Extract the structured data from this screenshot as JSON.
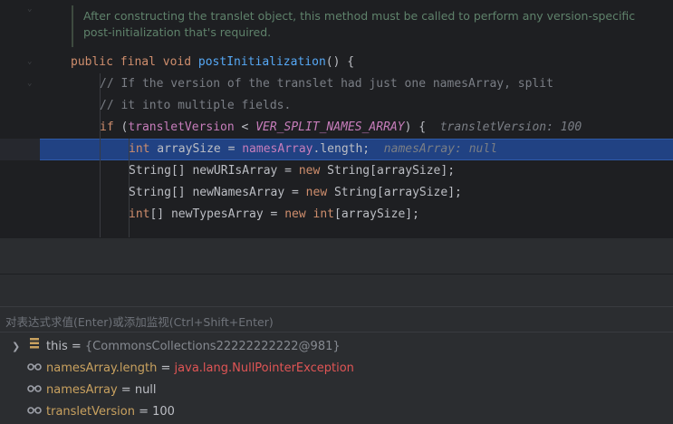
{
  "editor": {
    "doc_comment": [
      "After constructing the translet object, this method must be called to perform any version-specific",
      "post-initialization that's required."
    ],
    "method_line": {
      "modifiers": "public final void ",
      "name": "postInitialization",
      "rest": "() {"
    },
    "comment_lines": [
      "// If the version of the translet had just one namesArray, split",
      "// it into multiple fields."
    ],
    "if_line": {
      "kw": "if",
      "open": " (",
      "field": "transletVersion",
      "op": " < ",
      "const": "VER_SPLIT_NAMES_ARRAY",
      "close": ") {",
      "hint": "transletVersion: 100"
    },
    "highlight_line": {
      "type": "int",
      "decl": " arraySize = ",
      "field": "namesArray",
      "member": ".length;",
      "hint": "namesArray: null"
    },
    "line_uris": {
      "pre": "String[] newURIsArray = ",
      "new": "new",
      "post": " String[arraySize];"
    },
    "line_names": {
      "pre": "String[] newNamesArray = ",
      "new": "new",
      "post": " String[arraySize];"
    },
    "line_types": {
      "type": "int",
      "mid": "[] newTypesArray = ",
      "new": "new",
      "type2": " int",
      "post": "[arraySize];"
    }
  },
  "evaluate": {
    "placeholder": "对表达式求值(Enter)或添加监视(Ctrl+Shift+Enter)"
  },
  "variables": [
    {
      "name": "this",
      "eq": " = ",
      "value": "{CommonsCollections22222222222@981}",
      "icon": "field-icon",
      "expandable": true
    },
    {
      "name": "namesArray.length",
      "eq": " = ",
      "value": "java.lang.NullPointerException",
      "icon": "watch-icon",
      "expandable": false,
      "error": true
    },
    {
      "name": "namesArray",
      "eq": " = ",
      "value": "null",
      "icon": "watch-icon",
      "expandable": false
    },
    {
      "name": "transletVersion",
      "eq": " = ",
      "value": "100",
      "icon": "watch-icon",
      "expandable": false
    }
  ],
  "colors": {
    "editor_bg": "#1e1f22",
    "highlight": "#214283",
    "keyword": "#cf8e6d",
    "method": "#56a8f5",
    "field": "#c77dbb",
    "error": "#e05555"
  }
}
